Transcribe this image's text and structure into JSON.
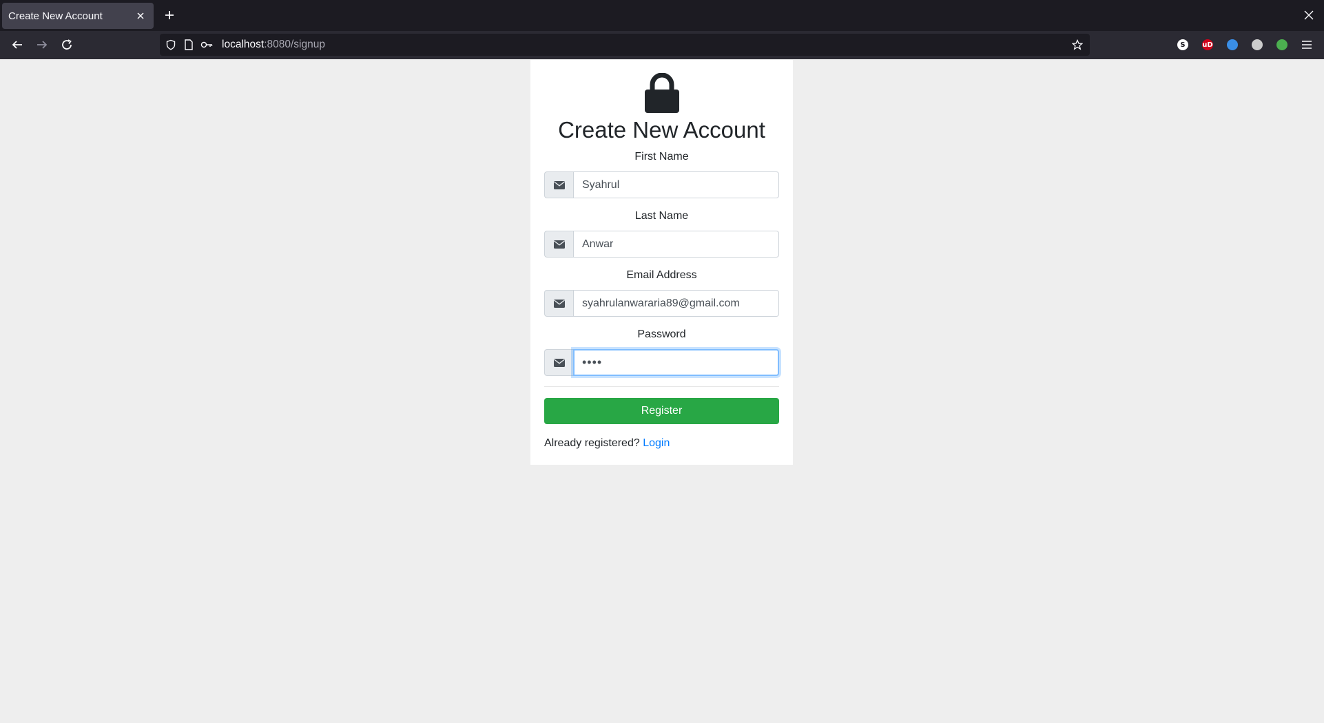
{
  "browser": {
    "tab_title": "Create New Account",
    "url_host": "localhost",
    "url_path": ":8080/signup"
  },
  "extensions": [
    {
      "name": "s-extension-icon",
      "glyph": "S",
      "color": "#ffffff",
      "text_color": "#1c1b22"
    },
    {
      "name": "ublock-icon",
      "glyph": "uD",
      "color": "#d0021b",
      "text_color": "#ffffff"
    },
    {
      "name": "blue-extension-icon",
      "glyph": "",
      "color": "#3a8ee6",
      "text_color": "#ffffff"
    },
    {
      "name": "feather-extension-icon",
      "glyph": "",
      "color": "#cccccc",
      "text_color": "#ffffff"
    },
    {
      "name": "green-extension-icon",
      "glyph": "",
      "color": "#4caf50",
      "text_color": "#ffffff"
    }
  ],
  "page": {
    "title": "Create New Account",
    "fields": [
      {
        "label": "First Name",
        "value": "Syahrul",
        "type": "text"
      },
      {
        "label": "Last Name",
        "value": "Anwar",
        "type": "text"
      },
      {
        "label": "Email Address",
        "value": "syahrulanwararia89@gmail.com",
        "type": "email"
      },
      {
        "label": "Password",
        "value": "••••",
        "type": "password"
      }
    ],
    "submit_label": "Register",
    "login_prompt": "Already registered?",
    "login_link": "Login"
  },
  "colors": {
    "submit": "#28a745",
    "link": "#007bff",
    "focus_border": "#80bdff"
  }
}
